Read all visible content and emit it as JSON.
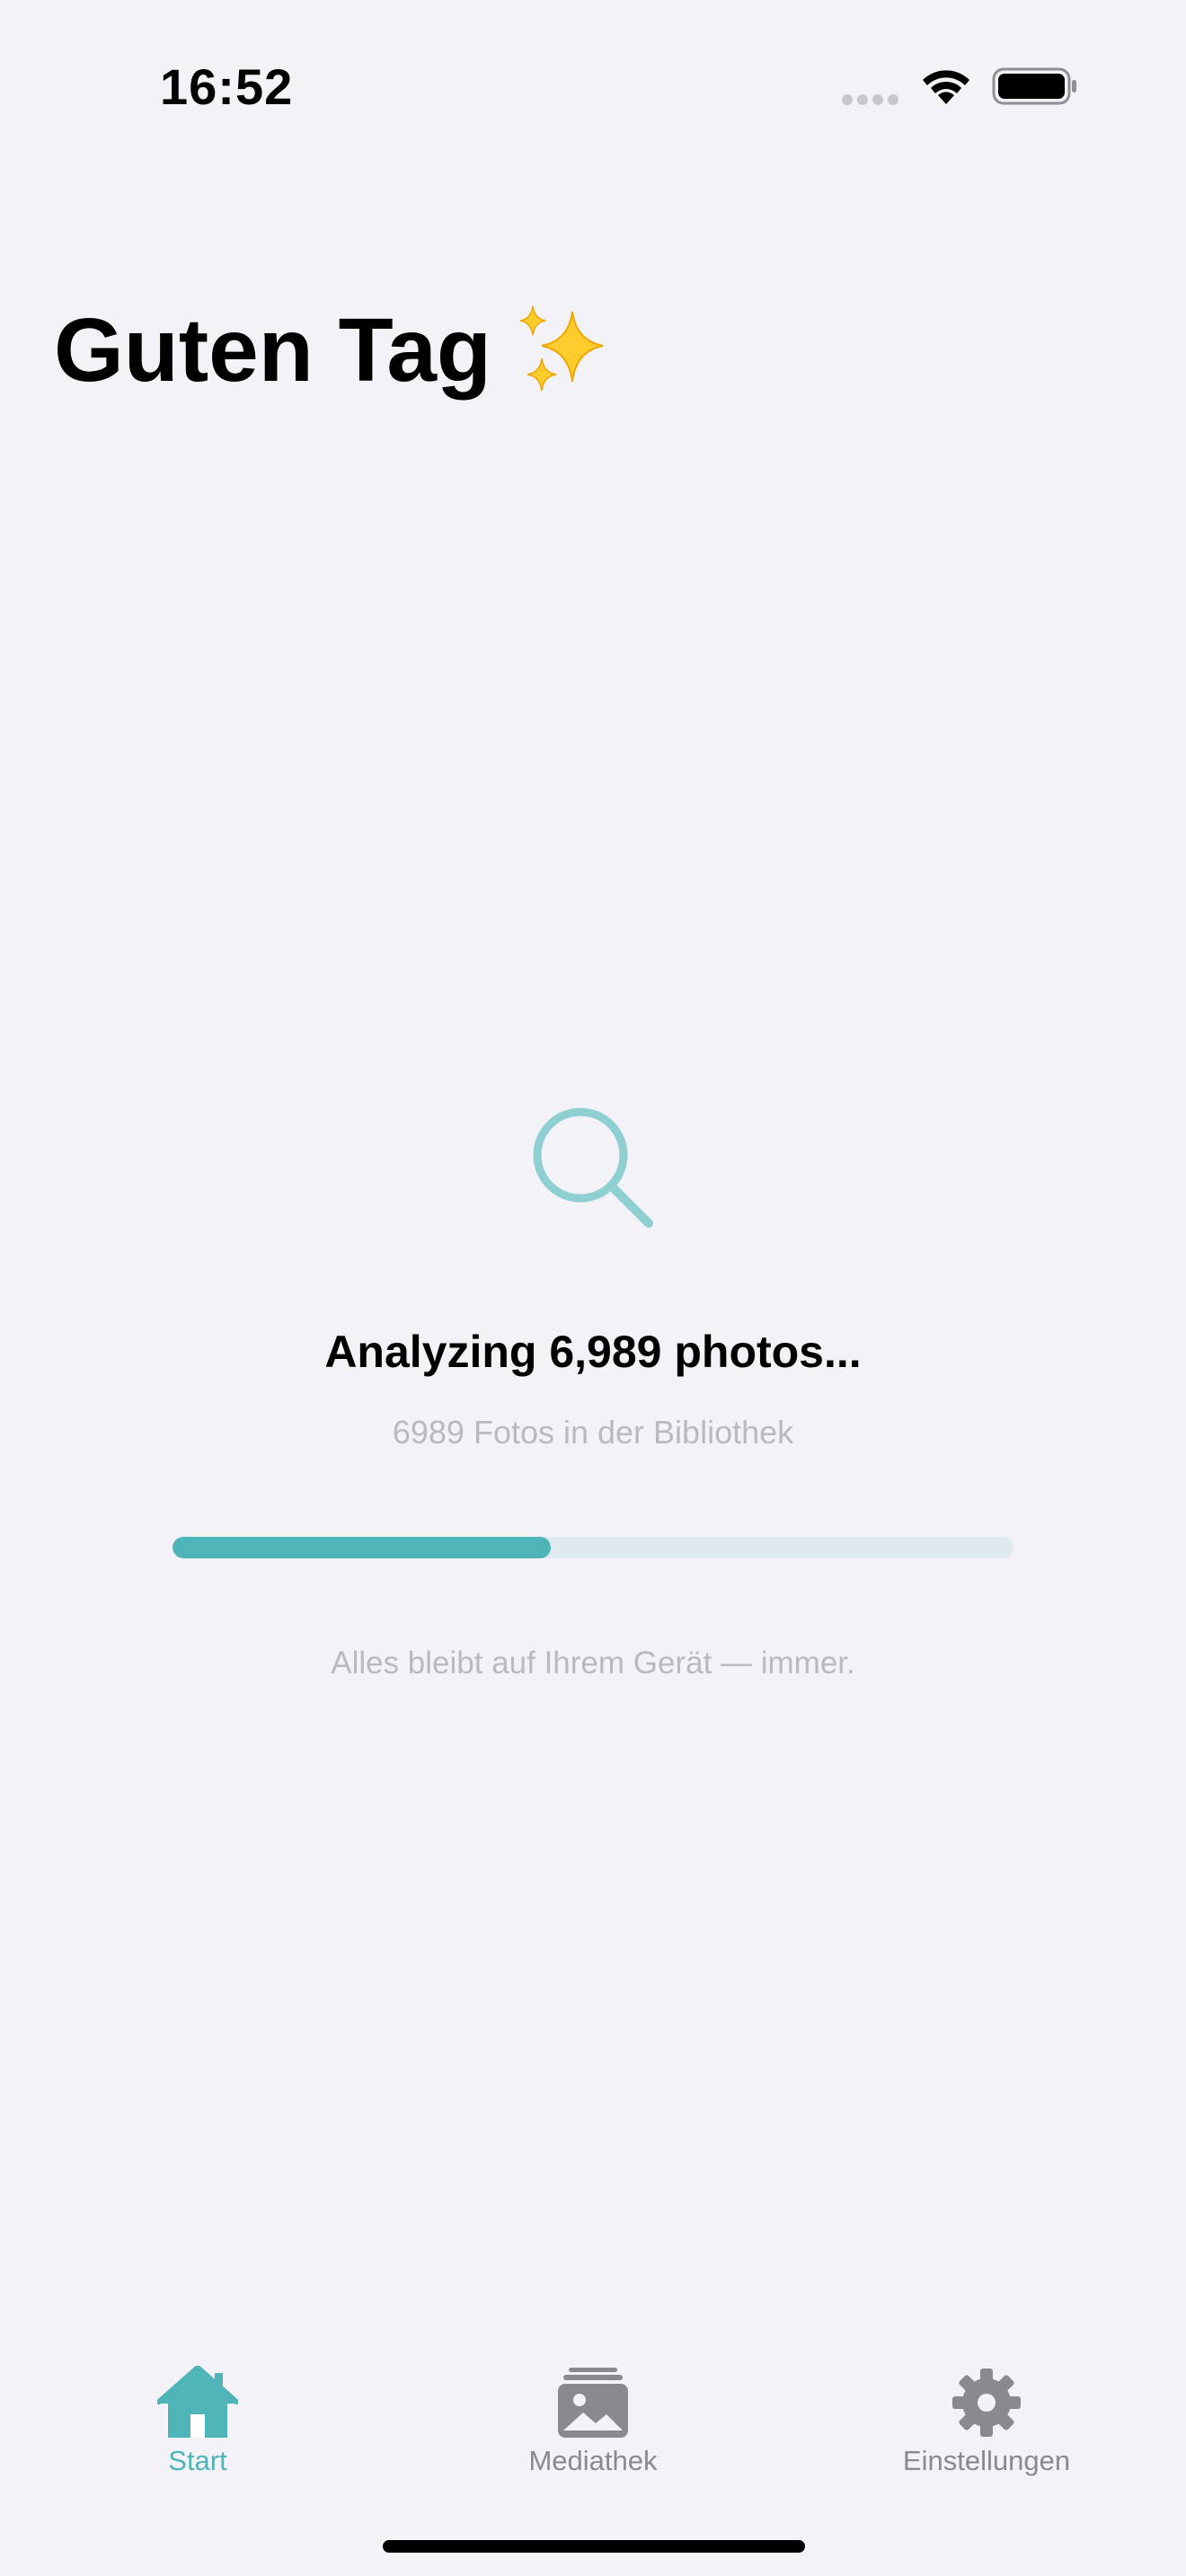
{
  "status_bar": {
    "time": "16:52",
    "icons": [
      "signal-dots-icon",
      "wifi-icon",
      "battery-icon"
    ]
  },
  "header": {
    "title": "Guten Tag",
    "title_icon": "sparkles-icon"
  },
  "analysis": {
    "icon": "magnifier-icon",
    "title": "Analyzing 6,989 photos...",
    "subtitle": "6989 Fotos in der Bibliothek",
    "progress": 0.45,
    "privacy_note": "Alles bleibt auf Ihrem Gerät — immer."
  },
  "tab_bar": {
    "tabs": [
      {
        "label": "Start",
        "icon": "home-icon",
        "active": true
      },
      {
        "label": "Mediathek",
        "icon": "photo-library-icon",
        "active": false
      },
      {
        "label": "Einstellungen",
        "icon": "gear-icon",
        "active": false
      }
    ]
  },
  "colors": {
    "accent": "#4fb4b8",
    "progress_track": "#dfeaf0",
    "background": "#f2f2f7",
    "secondary_text": "#b9b9bf",
    "inactive_tab": "#8a8a8e"
  }
}
